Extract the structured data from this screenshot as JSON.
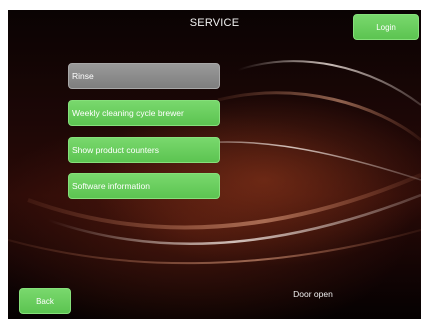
{
  "header": {
    "title": "SERVICE",
    "login_label": "Login"
  },
  "menu": [
    {
      "label": "Rinse",
      "state": "disabled"
    },
    {
      "label": "Weekly cleaning cycle brewer",
      "state": "enabled"
    },
    {
      "label": "Show product counters",
      "state": "enabled"
    },
    {
      "label": "Software information",
      "state": "enabled"
    }
  ],
  "footer": {
    "back_label": "Back",
    "status_text": "Door open"
  },
  "colors": {
    "button_green": "#66cc5a",
    "button_disabled": "#8a8a8a",
    "background_dark": "#1c0706",
    "swoosh_highlight": "#d8c8c0"
  }
}
